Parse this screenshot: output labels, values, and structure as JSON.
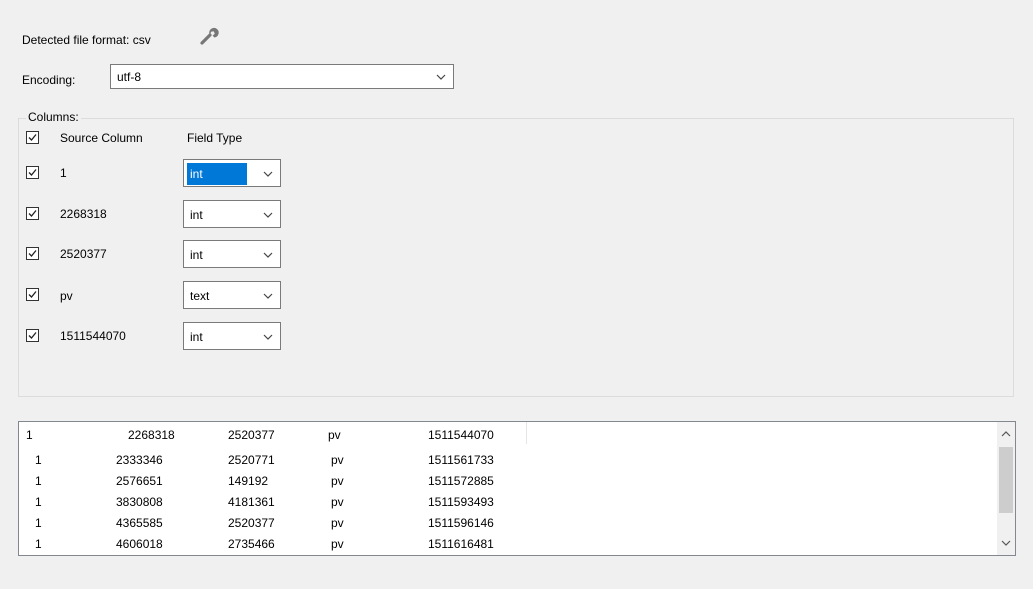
{
  "detected": {
    "label": "Detected file format: csv",
    "tool_icon": "wrench-icon"
  },
  "encoding": {
    "label": "Encoding:",
    "value": "utf-8"
  },
  "columns": {
    "title": "Columns:",
    "header": {
      "source": "Source Column",
      "type": "Field Type"
    },
    "rows": [
      {
        "name": "1",
        "type": "int",
        "checked": true
      },
      {
        "name": "2268318",
        "type": "int",
        "checked": true
      },
      {
        "name": "2520377",
        "type": "int",
        "checked": true
      },
      {
        "name": "pv",
        "type": "text",
        "checked": true
      },
      {
        "name": "1511544070",
        "type": "int",
        "checked": true
      }
    ]
  },
  "preview": {
    "header": [
      "1",
      "2268318",
      "2520377",
      "pv",
      "1511544070"
    ],
    "rows": [
      [
        "1",
        "2333346",
        "2520771",
        "pv",
        "1511561733"
      ],
      [
        "1",
        "2576651",
        "149192",
        "pv",
        "1511572885"
      ],
      [
        "1",
        "3830808",
        "4181361",
        "pv",
        "1511593493"
      ],
      [
        "1",
        "4365585",
        "2520377",
        "pv",
        "1511596146"
      ],
      [
        "1",
        "4606018",
        "2735466",
        "pv",
        "1511616481"
      ]
    ]
  },
  "colors": {
    "selection": "#0078d7",
    "scrollbar_thumb": "#cdcdcd"
  }
}
